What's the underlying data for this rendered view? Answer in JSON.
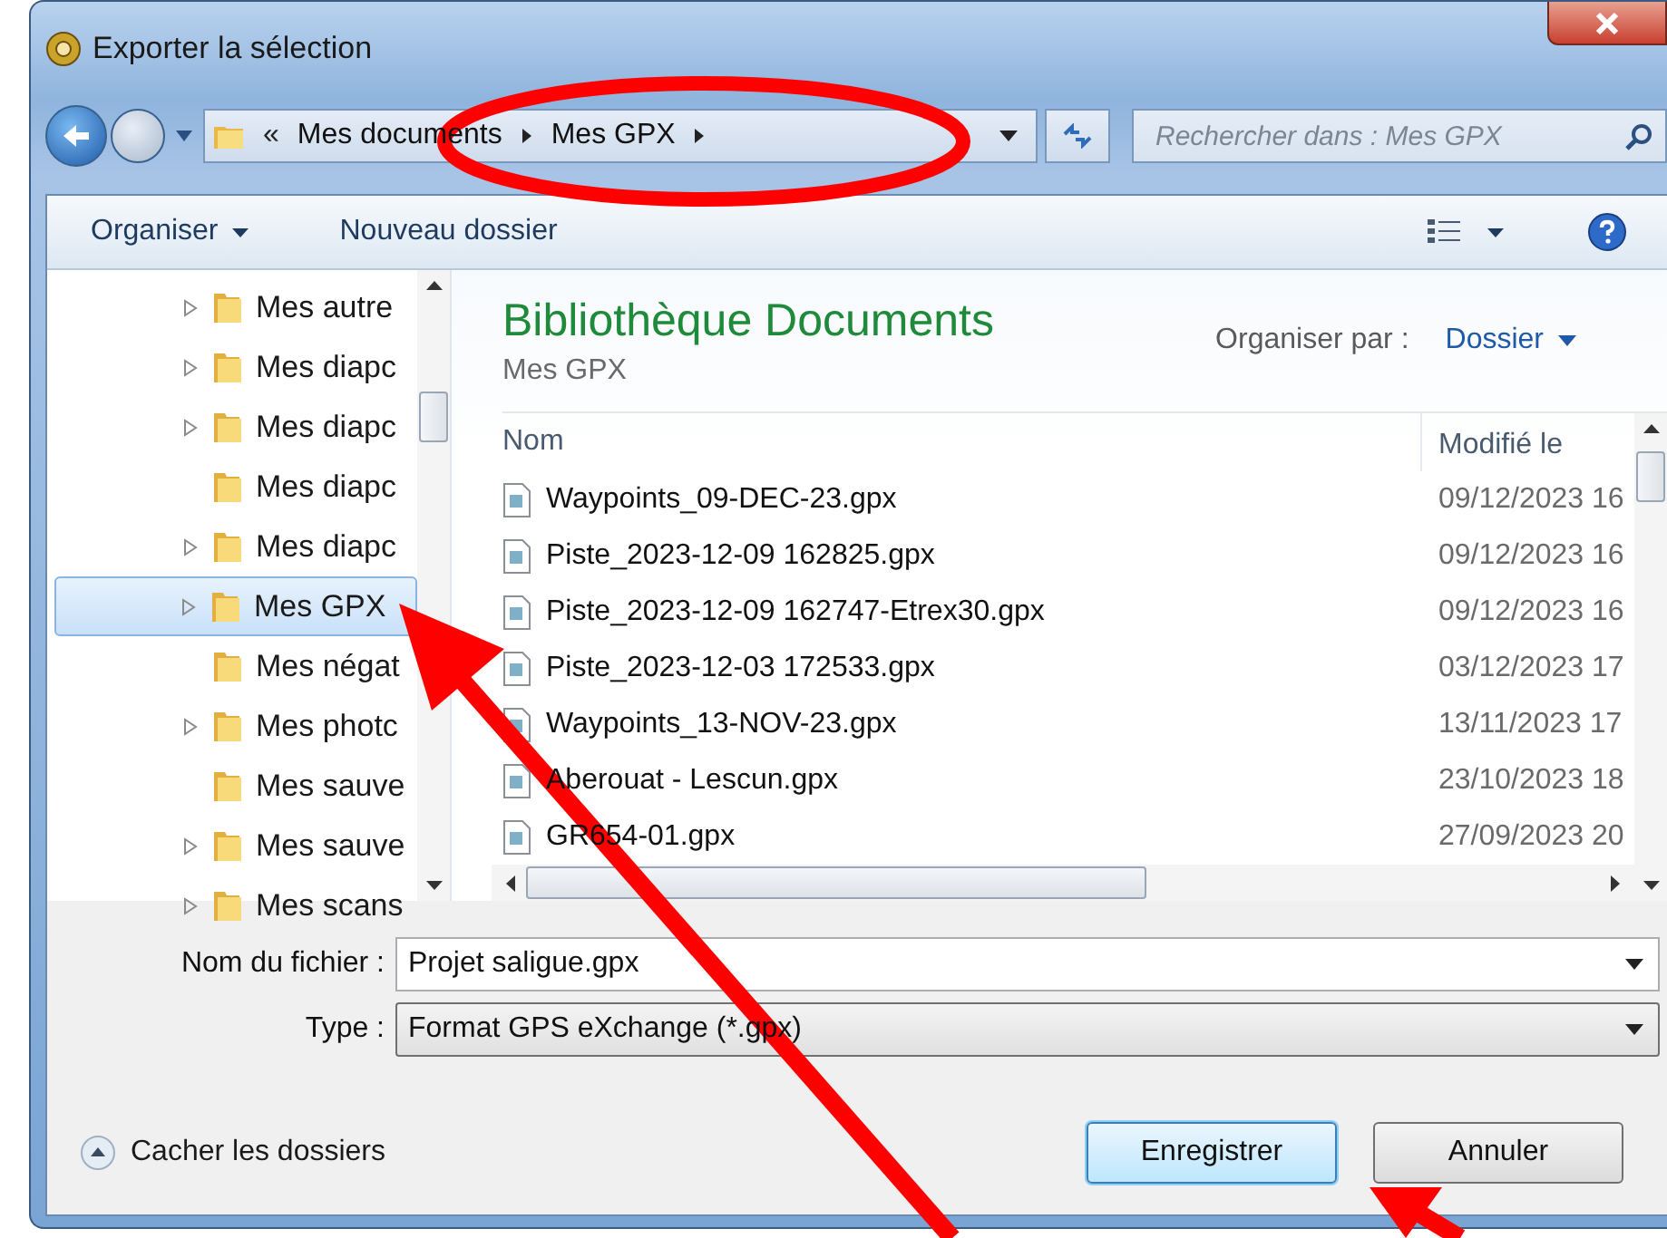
{
  "window": {
    "title": "Exporter la sélection"
  },
  "address_bar": {
    "overflow": "«",
    "crumbs": [
      "Mes documents",
      "Mes GPX"
    ]
  },
  "search": {
    "placeholder": "Rechercher dans : Mes GPX"
  },
  "toolbar": {
    "items": [
      {
        "label": "Organiser",
        "kind": "menu"
      },
      {
        "label": "Nouveau dossier",
        "kind": "button"
      }
    ]
  },
  "sidebar": {
    "items": [
      {
        "label": "Mes autre",
        "expandable": true,
        "selected": false
      },
      {
        "label": "Mes diapc",
        "expandable": true,
        "selected": false
      },
      {
        "label": "Mes diapc",
        "expandable": true,
        "selected": false
      },
      {
        "label": "Mes diapc",
        "expandable": false,
        "selected": false
      },
      {
        "label": "Mes diapc",
        "expandable": true,
        "selected": false
      },
      {
        "label": "Mes GPX",
        "expandable": true,
        "selected": true
      },
      {
        "label": "Mes négat",
        "expandable": false,
        "selected": false
      },
      {
        "label": "Mes photc",
        "expandable": true,
        "selected": false
      },
      {
        "label": "Mes sauve",
        "expandable": false,
        "selected": false
      },
      {
        "label": "Mes sauve",
        "expandable": true,
        "selected": false
      },
      {
        "label": "Mes scans",
        "expandable": true,
        "selected": false
      }
    ]
  },
  "library": {
    "title": "Bibliothèque Documents",
    "subtitle": "Mes GPX",
    "arrange_label": "Organiser par :",
    "arrange_value": "Dossier"
  },
  "table": {
    "columns": [
      "Nom",
      "Modifié le"
    ],
    "rows": [
      {
        "name": "Waypoints_09-DEC-23.gpx",
        "modified": "09/12/2023 16"
      },
      {
        "name": "Piste_2023-12-09 162825.gpx",
        "modified": "09/12/2023 16"
      },
      {
        "name": "Piste_2023-12-09 162747-Etrex30.gpx",
        "modified": "09/12/2023 16"
      },
      {
        "name": "Piste_2023-12-03 172533.gpx",
        "modified": "03/12/2023 17"
      },
      {
        "name": "Waypoints_13-NOV-23.gpx",
        "modified": "13/11/2023 17"
      },
      {
        "name": "Aberouat - Lescun.gpx",
        "modified": "23/10/2023 18"
      },
      {
        "name": "GR654-01.gpx",
        "modified": "27/09/2023 20"
      }
    ]
  },
  "filename": {
    "label": "Nom du fichier :",
    "value": "Projet saligue.gpx"
  },
  "type": {
    "label": "Type :",
    "value": "Format GPS eXchange (*.gpx)"
  },
  "hide_folders": "Cacher les dossiers",
  "buttons": [
    {
      "label": "Enregistrer",
      "default": true
    },
    {
      "label": "Annuler",
      "default": false
    }
  ]
}
